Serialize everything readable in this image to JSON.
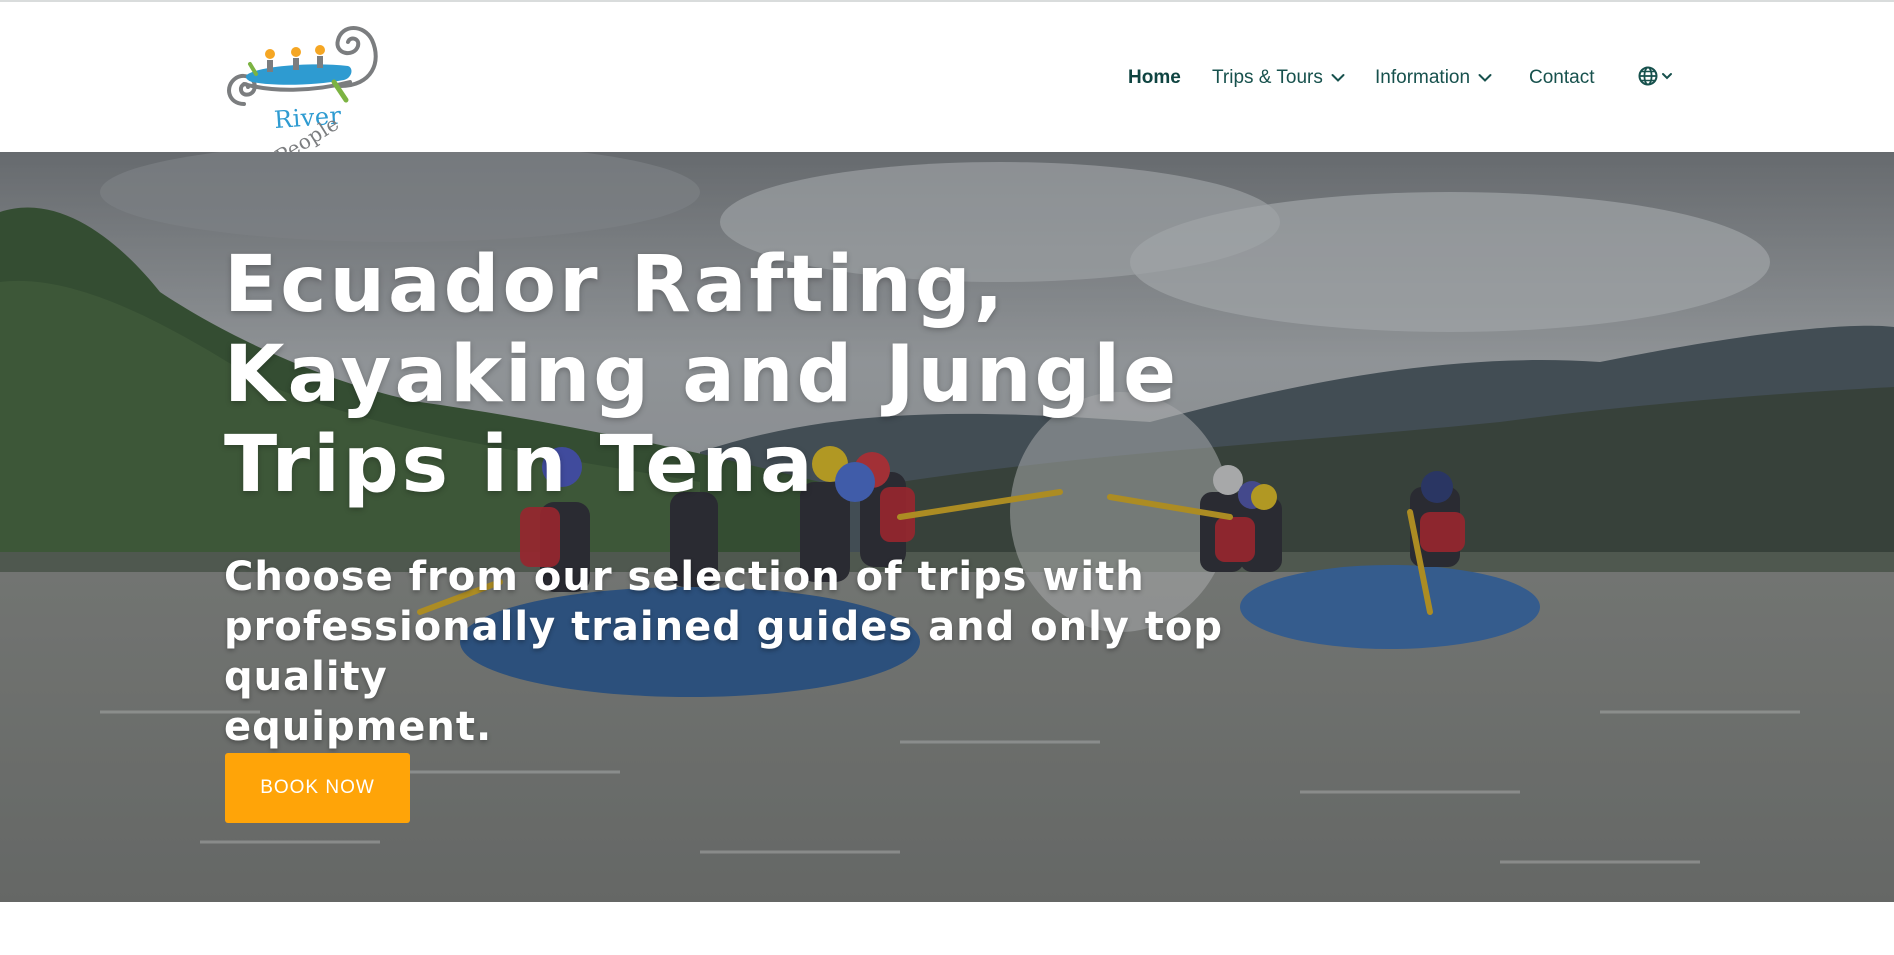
{
  "header": {
    "logo": {
      "word_river": "River",
      "word_people": "People",
      "colors": {
        "blue": "#2e9bd1",
        "gray": "#7b7d7f",
        "orange": "#f5a623",
        "green": "#7cb342"
      }
    },
    "nav": {
      "home": "Home",
      "trips": "Trips & Tours",
      "info": "Information",
      "contact": "Contact",
      "language_icon": "globe-icon"
    },
    "nav_color": "#17514d"
  },
  "hero": {
    "title_lines": [
      "Ecuador Rafting,",
      "Kayaking and Jungle",
      "Trips in Tena"
    ],
    "subtitle_lines": [
      "Choose from our selection of trips with",
      "professionally trained guides and only top quality",
      "equipment."
    ],
    "cta_label": "BOOK NOW",
    "cta_color": "#ffa408",
    "background_subject": "rafting-photo"
  }
}
